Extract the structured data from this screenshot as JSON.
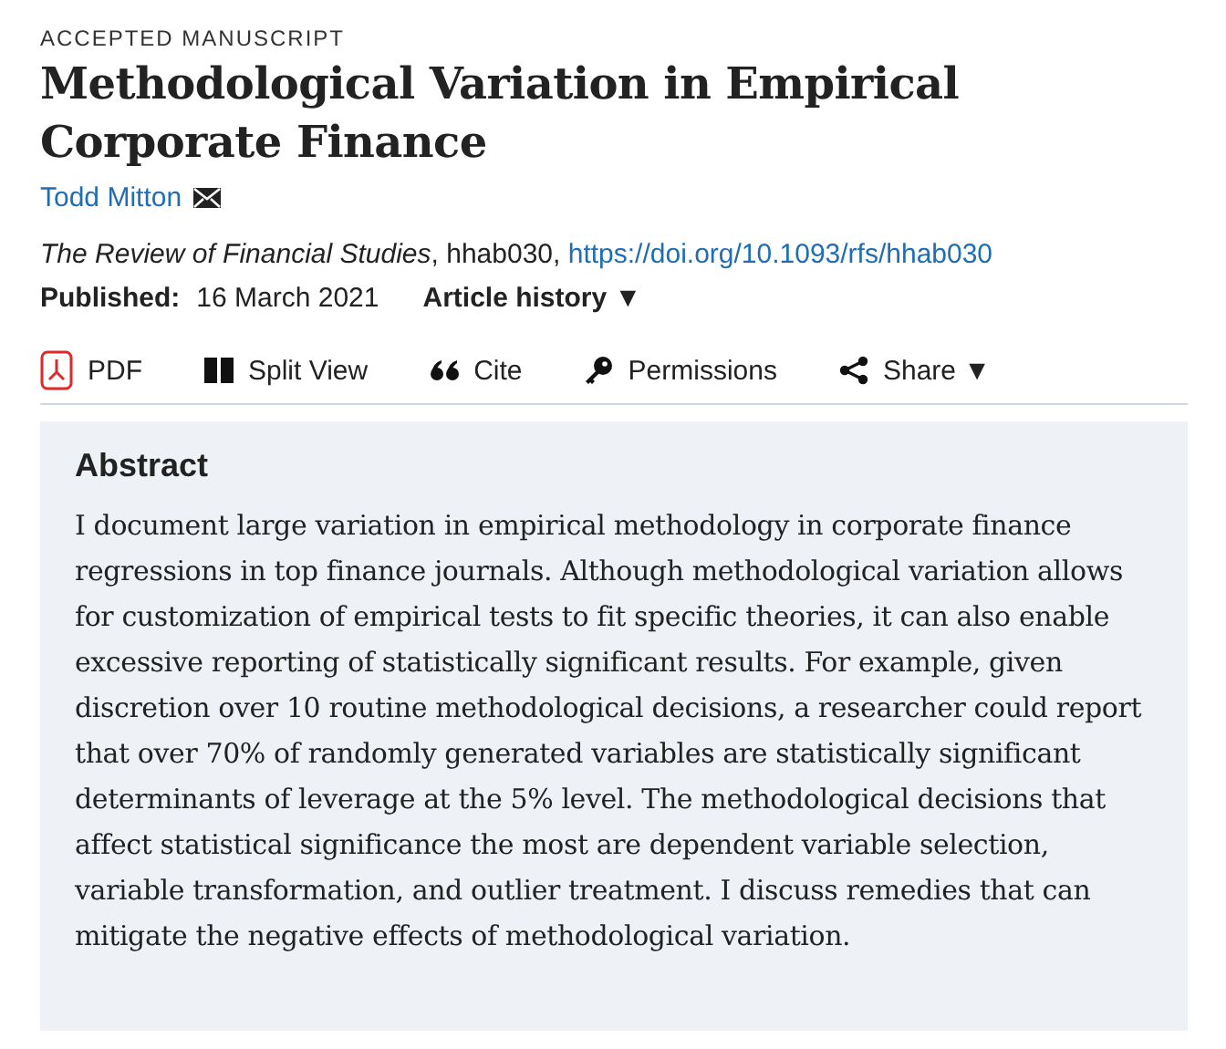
{
  "label": "ACCEPTED MANUSCRIPT",
  "title": "Methodological Variation in Empirical Corporate Finance",
  "author": "Todd Mitton",
  "citation": {
    "journal": "The Review of Financial Studies",
    "id": ", hhab030, ",
    "doi": "https://doi.org/10.1093/rfs/hhab030"
  },
  "published": {
    "label": "Published:",
    "date": "16 March 2021"
  },
  "history": {
    "label": "Article history",
    "caret": "▼"
  },
  "toolbar": [
    {
      "kind": "pdf",
      "label": "PDF"
    },
    {
      "kind": "split",
      "label": "Split View"
    },
    {
      "kind": "cite",
      "label": "Cite"
    },
    {
      "kind": "key",
      "label": "Permissions"
    },
    {
      "kind": "share",
      "label": "Share",
      "caret": "▼"
    }
  ],
  "abstract": {
    "heading": "Abstract",
    "text": "I document large variation in empirical methodology in corporate finance regressions in top finance journals. Although methodological variation allows for customization of empirical tests to fit specific theories, it can also enable excessive reporting of statistically significant results. For example, given discretion over 10 routine methodological decisions, a researcher could report that over 70% of randomly generated variables are statistically significant determinants of leverage at the 5% level. The methodological decisions that affect statistical significance the most are dependent variable selection, variable transformation, and outlier treatment. I discuss remedies that can mitigate the negative effects of methodological variation."
  }
}
